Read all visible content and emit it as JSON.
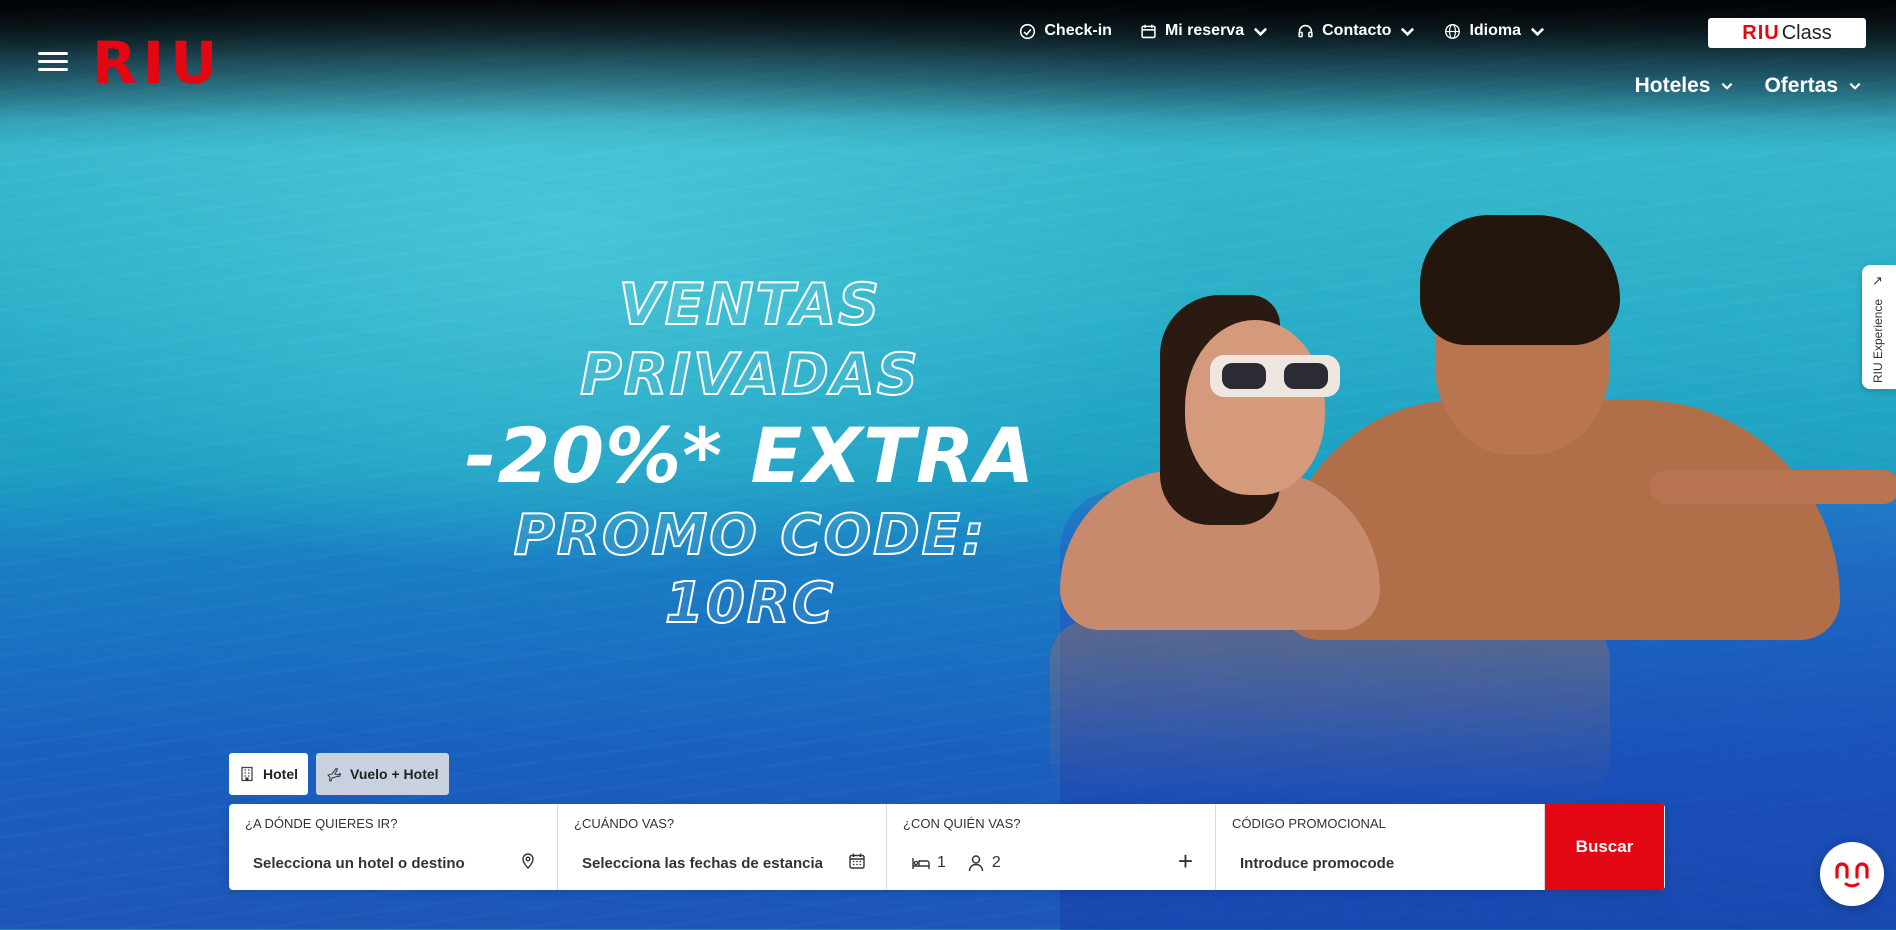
{
  "header": {
    "logo_text": "RIU",
    "utility": {
      "checkin": "Check-in",
      "reserva": "Mi reserva",
      "contacto": "Contacto",
      "idioma": "Idioma"
    },
    "riuclass": {
      "brand": "RIU",
      "label": "Class"
    },
    "nav": {
      "hoteles": "Hoteles",
      "ofertas": "Ofertas"
    },
    "brand_color": "#e30613"
  },
  "promo": {
    "line1": "VENTAS PRIVADAS",
    "line2": "-20%* EXTRA",
    "line3": "PROMO CODE: 10RC"
  },
  "side_tab": {
    "label": "RIU Experience",
    "arrow": "↗"
  },
  "booking": {
    "tabs": [
      {
        "label": "Hotel",
        "icon": "building-icon",
        "active": true
      },
      {
        "label": "Vuelo + Hotel",
        "icon": "plane-icon",
        "active": false
      }
    ],
    "destination": {
      "label": "¿A DÓNDE QUIERES IR?",
      "value": "Selecciona un hotel o destino",
      "icon": "location-pin-icon"
    },
    "dates": {
      "label": "¿CUÁNDO VAS?",
      "value": "Selecciona las fechas de estancia",
      "icon": "calendar-icon"
    },
    "guests": {
      "label": "¿CON QUIÉN VAS?",
      "rooms": "1",
      "people": "2",
      "add": "+"
    },
    "promo_code": {
      "label": "CÓDIGO PROMOCIONAL",
      "placeholder": "Introduce promocode"
    },
    "search_label": "Buscar"
  },
  "chat": {
    "icon": "chat-face-icon"
  }
}
